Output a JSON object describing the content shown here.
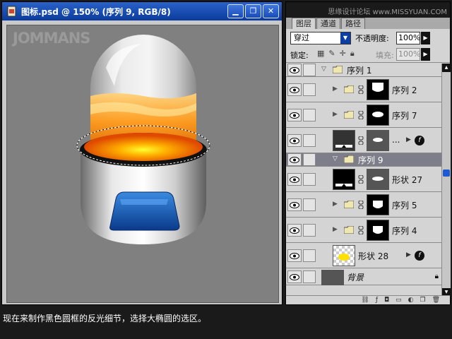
{
  "window": {
    "title": "图标.psd @ 150% (序列 9, RGB/8)",
    "buttons": {
      "minimize": "▁",
      "restore": "❐",
      "close": "✕"
    }
  },
  "canvas": {
    "watermark": "JOMMANS"
  },
  "site_watermark": "思缘设计论坛 www.MISSYUAN.COM",
  "palette": {
    "tabs": [
      "图层",
      "通道",
      "路径"
    ],
    "blend_mode": "穿过",
    "opacity_label": "不透明度:",
    "opacity_value": "100%",
    "lock_label": "锁定:",
    "fill_label": "填充:",
    "fill_value": "100%",
    "layers": [
      {
        "name": "序列 1",
        "type": "group-open"
      },
      {
        "name": "序列 2",
        "type": "group",
        "thumb": "black"
      },
      {
        "name": "序列 7",
        "type": "group",
        "thumb": "black"
      },
      {
        "name": "...",
        "type": "adjust"
      },
      {
        "name": "序列 9",
        "type": "group-selected"
      },
      {
        "name": "形状 27",
        "type": "shape"
      },
      {
        "name": "序列 5",
        "type": "group",
        "thumb": "black"
      },
      {
        "name": "序列 4",
        "type": "group",
        "thumb": "black"
      },
      {
        "name": "形状 28",
        "type": "shape-check"
      },
      {
        "name": "背景",
        "type": "background"
      }
    ]
  },
  "caption": "现在来制作黑色圆框的反光细节，选择大椭圆的选区。",
  "colors": {
    "title_bar": "#1a4cb8",
    "canvas_bg": "#808080",
    "accent_orange": "#ff9a1a",
    "accent_blue": "#1a5ab0"
  }
}
